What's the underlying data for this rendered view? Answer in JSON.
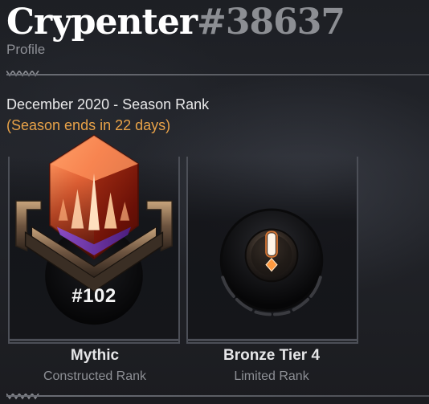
{
  "profile": {
    "player_name": "Crypenter",
    "player_tag": "#38637",
    "subtitle": "Profile"
  },
  "season": {
    "title": "December 2020 - Season Rank",
    "ends_text": "(Season ends in 22 days)"
  },
  "ranks": {
    "constructed": {
      "number": "#102",
      "tier": "Mythic",
      "format": "Constructed Rank",
      "icon": "mythic-gem-icon"
    },
    "limited": {
      "tier": "Bronze Tier 4",
      "format": "Limited Rank",
      "icon": "bronze-progress-icon"
    }
  },
  "colors": {
    "accent": "#e8a248",
    "tag_gray": "#8c8e93",
    "text_light": "#e6e6e8",
    "text_muted": "#8d8f95"
  }
}
